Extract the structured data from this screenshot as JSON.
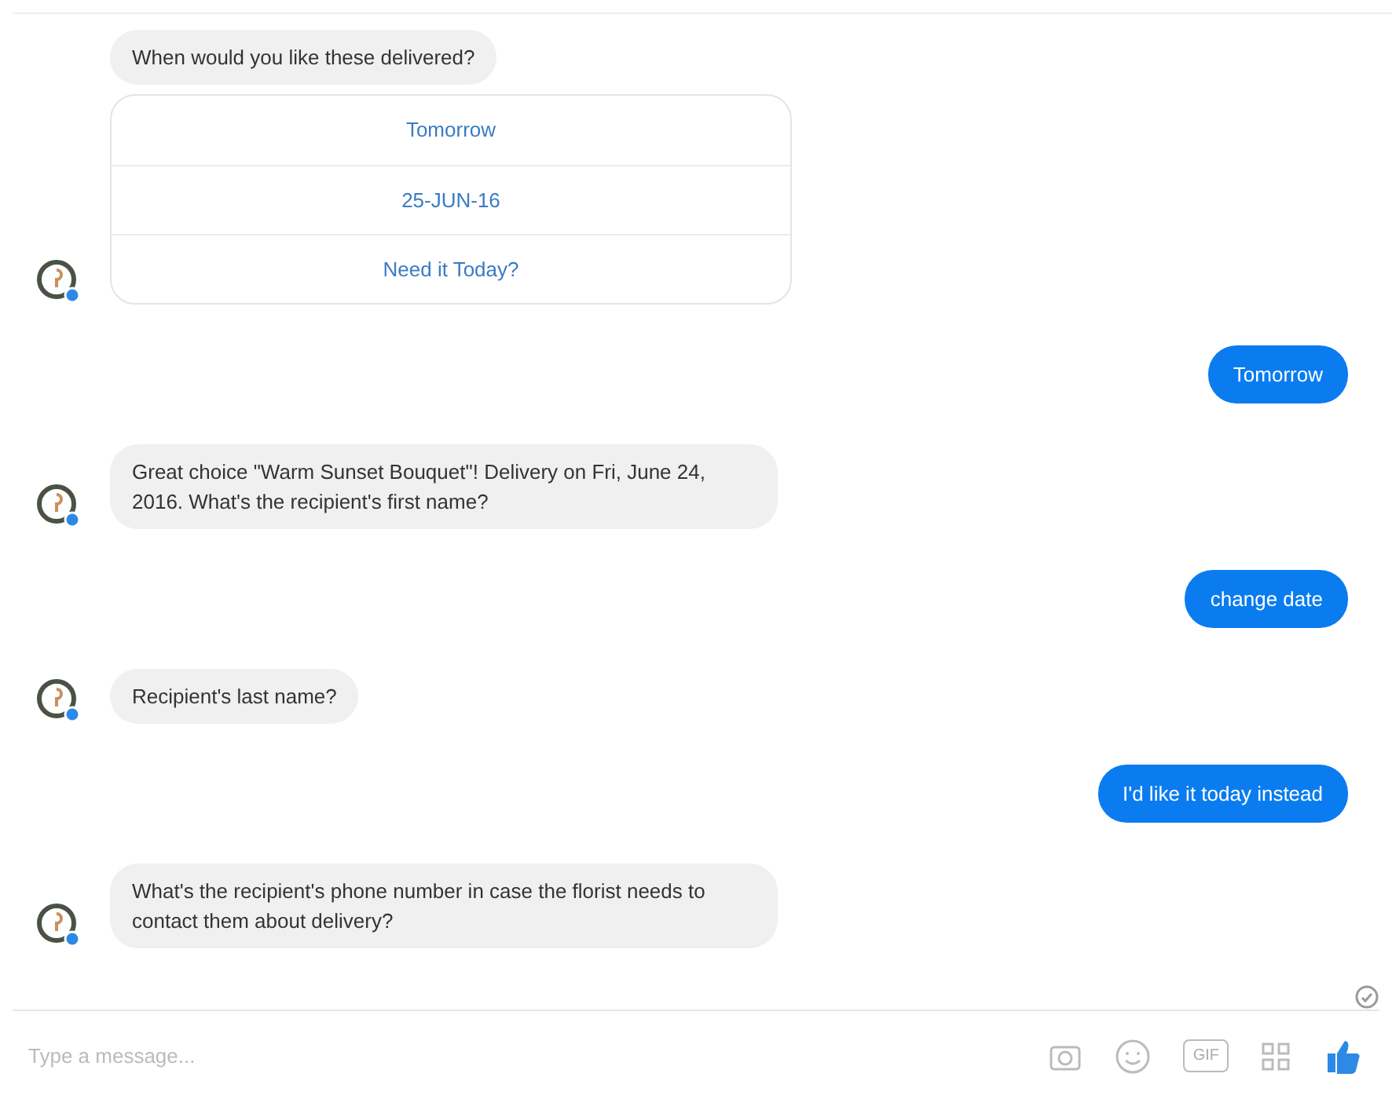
{
  "messages": [
    {
      "kind": "bot",
      "text": "When would you like these delivered?",
      "avatar": false
    },
    {
      "kind": "quick_replies",
      "options": [
        "Tomorrow",
        "25-JUN-16",
        "Need it Today?"
      ],
      "avatar": true
    },
    {
      "kind": "user",
      "text": "Tomorrow"
    },
    {
      "kind": "bot",
      "text": "Great choice \"Warm Sunset Bouquet\"! Delivery on Fri, June 24, 2016. What's the recipient's first name?",
      "avatar": true
    },
    {
      "kind": "user",
      "text": "change date"
    },
    {
      "kind": "bot",
      "text": "Recipient's last name?",
      "avatar": true
    },
    {
      "kind": "user",
      "text": "I'd like it today instead"
    },
    {
      "kind": "bot",
      "text": "What's the recipient's phone number in case the florist needs to contact them about delivery?",
      "avatar": true
    }
  ],
  "seen": true,
  "composer": {
    "placeholder": "Type a message...",
    "gif_label": "GIF"
  }
}
